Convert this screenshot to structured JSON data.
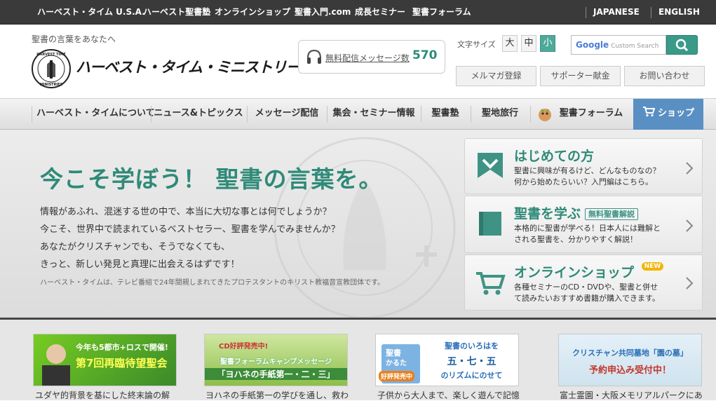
{
  "topnav": {
    "links": [
      "ハーベスト・タイム U.S.A.",
      "ハーベスト聖書塾",
      "オンラインショップ",
      "聖書入門.com",
      "成長セミナー",
      "聖書フォーラム"
    ],
    "lang": [
      "JAPANESE",
      "ENGLISH"
    ]
  },
  "header": {
    "tagline": "聖書の言葉をあなたへ",
    "logo_text": "ハーベスト・タイム・ミニストリーズ",
    "logo_emblem_text": [
      "HARVEST TIME",
      "MINISTRIES"
    ],
    "message_label": "無料配信メッセージ数",
    "message_count": "570",
    "font_size_label": "文字サイズ",
    "font_sizes": [
      "大",
      "中",
      "小"
    ],
    "font_size_selected": "小",
    "search_placeholder": "Custom Search",
    "search_brand": "Google",
    "buttons": [
      "メルマガ登録",
      "サポーター献金",
      "お問い合わせ"
    ]
  },
  "nav": {
    "items": [
      "ハーベスト・タイムについて",
      "ニュース&トピックス",
      "メッセージ配信",
      "集会・セミナー情報",
      "聖書塾",
      "聖地旅行",
      "聖書フォーラム"
    ],
    "shop": "ショップ"
  },
  "hero": {
    "headline": "今こそ学ぼう！ 聖書の言葉を。",
    "paragraph": [
      "情報があふれ、混迷する世の中で、本当に大切な事とは何でしょうか？",
      "今こそ、世界中で読まれているベストセラー、聖書を学んでみませんか？",
      "あなたがクリスチャンでも、そうでなくても、",
      "きっと、新しい発見と真理に出会えるはずです！"
    ],
    "note": "ハーベスト・タイムは、テレビ番組で24年間親しまれてきたプロテスタントのキリスト教福音宣教団体です。",
    "cards": [
      {
        "title": "はじめての方",
        "tag": "",
        "desc": [
          "聖書に興味が有るけど、どんなものなの？",
          "何から始めたらいい？入門編はこちら。"
        ]
      },
      {
        "title": "聖書を学ぶ",
        "tag": "無料聖書解説",
        "desc": [
          "本格的に聖書が学べる！日本人には難解と",
          "される聖書を、分かりやすく解説！"
        ]
      },
      {
        "title": "オンラインショップ",
        "tag": "NEW",
        "desc": [
          "各種セミナーのCD・DVDや、聖書と併せ",
          "て読みたいおすすめ書籍が購入できます。"
        ]
      }
    ]
  },
  "banners": [
    {
      "lines": [
        "今年も5都市+ロスで開催!",
        "第7回再臨待望聖会"
      ],
      "caption": "ユダヤ的背景を基にした終末論の解"
    },
    {
      "lines": [
        "CD好評発売中!",
        "聖書フォーラムキャンプメッセージ",
        "「ヨハネの手紙第一・二・三」"
      ],
      "caption": "ヨハネの手紙第一の学びを通し、救わ"
    },
    {
      "lines": [
        "聖書",
        "かるた",
        "好評発売中",
        "聖書のいろはを",
        "五・七・五",
        "のリズムにのせて"
      ],
      "caption": "子供から大人まで、楽しく遊んで記憶"
    },
    {
      "lines": [
        "クリスチャン共同墓地「園の墓」",
        "予約申込み受付中！"
      ],
      "caption": "富士霊園・大阪メモリアルパークにあ"
    }
  ],
  "colors": {
    "accent": "#2f8a78",
    "shop": "#5a8fc4",
    "topbar": "#3a3a3a"
  }
}
